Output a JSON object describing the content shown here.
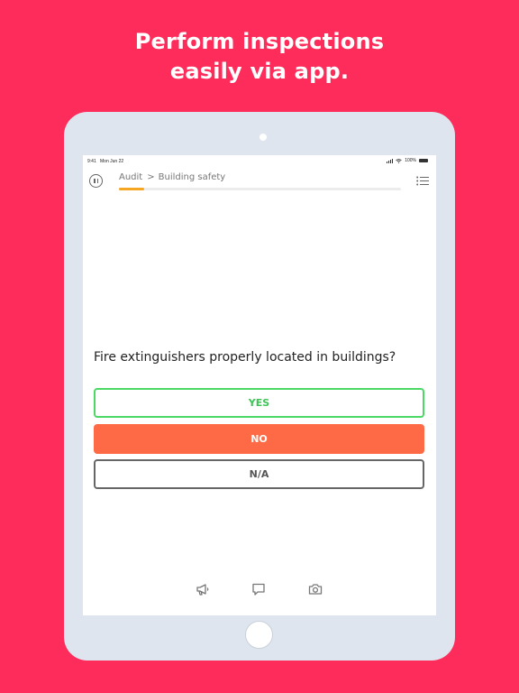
{
  "headline": {
    "line1": "Perform inspections",
    "line2": "easily via app."
  },
  "status_bar": {
    "time": "9:41",
    "date": "Mon Jun 22",
    "battery": "100%"
  },
  "header": {
    "breadcrumb_parent": "Audit",
    "breadcrumb_separator": ">",
    "breadcrumb_current": "Building safety",
    "progress_fraction": 0.09
  },
  "question": {
    "text": "Fire extinguishers properly located in buildings?"
  },
  "answers": {
    "yes": "YES",
    "no": "NO",
    "na": "N/A"
  },
  "icons": {
    "pause": "pause-icon",
    "list": "list-icon",
    "bottom": [
      "megaphone-icon",
      "comment-icon",
      "camera-icon"
    ]
  },
  "colors": {
    "background": "#fe2c5a",
    "yes": "#4cd963",
    "no": "#ff6a46",
    "progress": "#f5a623"
  }
}
